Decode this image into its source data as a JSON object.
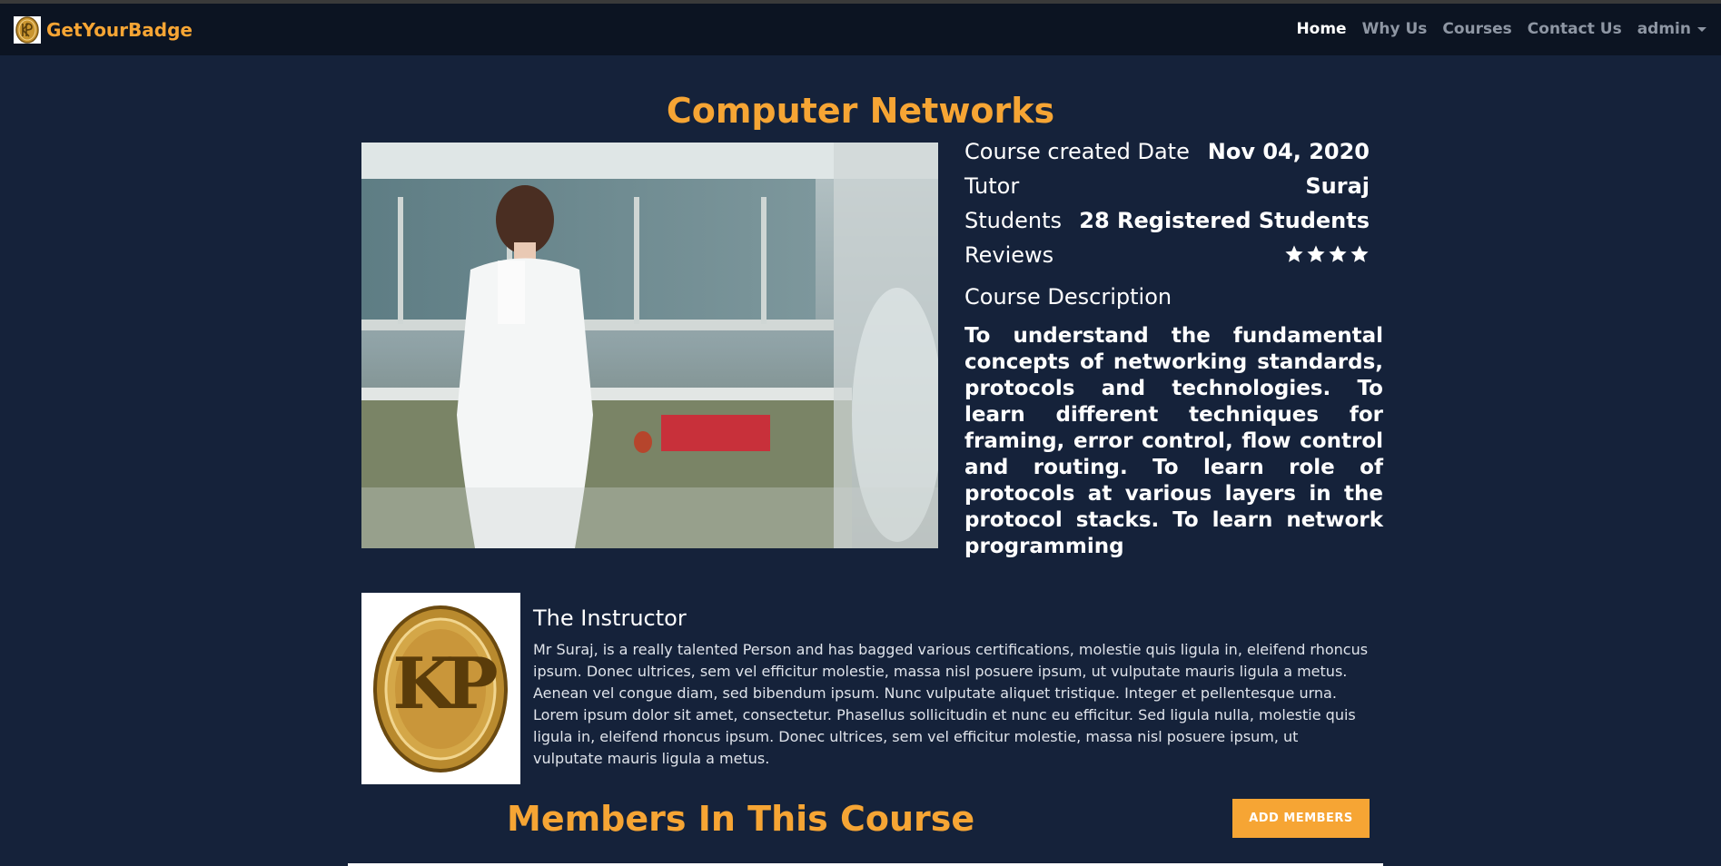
{
  "navbar": {
    "brand": "GetYourBadge",
    "links": [
      "Home",
      "Why Us",
      "Courses",
      "Contact Us",
      "admin"
    ]
  },
  "course": {
    "title": "Computer Networks",
    "created_label": "Course created Date",
    "created_value": "Nov 04, 2020",
    "tutor_label": "Tutor",
    "tutor_value": "Suraj",
    "students_label": "Students",
    "students_value": "28 Registered Students",
    "reviews_label": "Reviews",
    "reviews_stars": 4,
    "description_title": "Course Description",
    "description": "To understand the fundamental concepts of networking standards, protocols and technologies. To learn different techniques for framing, error control, flow control and routing. To learn role of protocols at various layers in the protocol stacks. To learn network programming"
  },
  "instructor": {
    "title": "The Instructor",
    "logo_text": "KP",
    "bio": "Mr Suraj, is a really talented Person and has bagged various certifications, molestie quis ligula in, eleifend rhoncus ipsum. Donec ultrices, sem vel efficitur molestie, massa nisl posuere ipsum, ut vulputate mauris ligula a metus. Aenean vel congue diam, sed bibendum ipsum. Nunc vulputate aliquet tristique. Integer et pellentesque urna. Lorem ipsum dolor sit amet, consectetur. Phasellus sollicitudin et nunc eu efficitur. Sed ligula nulla, molestie quis ligula in, eleifend rhoncus ipsum. Donec ultrices, sem vel efficitur molestie, massa nisl posuere ipsum, ut vulputate mauris ligula a metus."
  },
  "members": {
    "title": "Members In This Course",
    "add_button": "ADD MEMBERS"
  },
  "colors": {
    "background": "#15223a",
    "navbar": "#0c1422",
    "accent": "#f6a534"
  }
}
